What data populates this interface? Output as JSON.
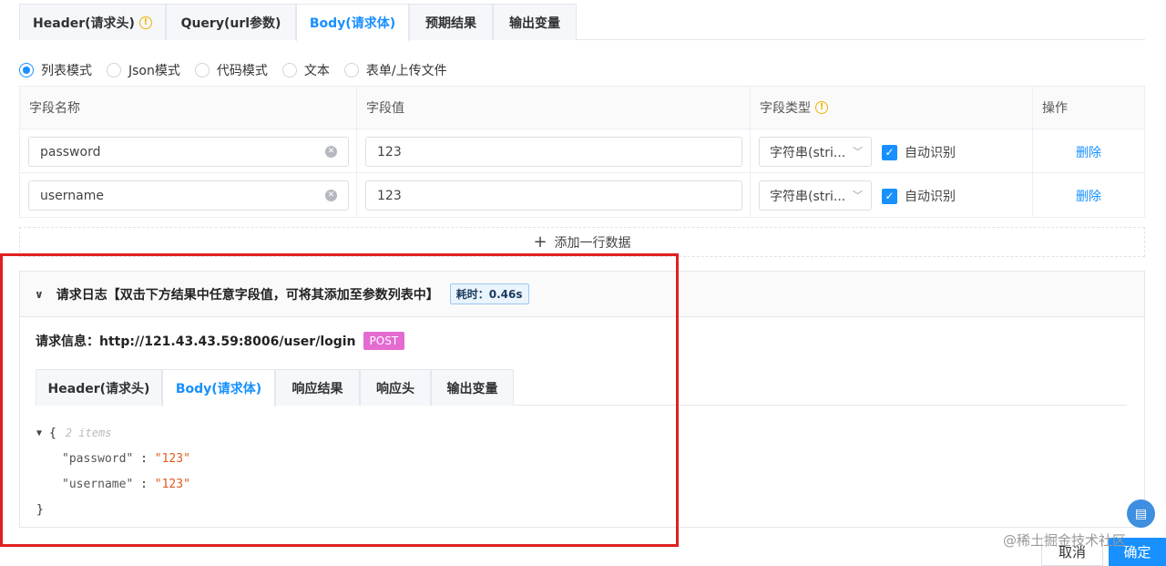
{
  "top_tabs": [
    {
      "label": "Header(请求头)"
    },
    {
      "label": "Query(url参数)"
    },
    {
      "label": "Body(请求体)"
    },
    {
      "label": "预期结果"
    },
    {
      "label": "输出变量"
    }
  ],
  "body_modes": [
    {
      "label": "列表模式"
    },
    {
      "label": "Json模式"
    },
    {
      "label": "代码模式"
    },
    {
      "label": "文本"
    },
    {
      "label": "表单/上传文件"
    }
  ],
  "table": {
    "headers": {
      "name": "字段名称",
      "value": "字段值",
      "type": "字段类型",
      "action": "操作"
    },
    "rows": [
      {
        "name": "password",
        "value": "123",
        "type": "字符串(stri...",
        "auto": "自动识别",
        "delete": "删除"
      },
      {
        "name": "username",
        "value": "123",
        "type": "字符串(stri...",
        "auto": "自动识别",
        "delete": "删除"
      }
    ],
    "add_row": "添加一行数据"
  },
  "log": {
    "title": "请求日志【双击下方结果中任意字段值，可将其添加至参数列表中】",
    "time_badge": "耗时：0.46s",
    "request_info": "请求信息：http://121.43.43.59:8006/user/login",
    "method": "POST",
    "tabs": [
      {
        "label": "Header(请求头)"
      },
      {
        "label": "Body(请求体)"
      },
      {
        "label": "响应结果"
      },
      {
        "label": "响应头"
      },
      {
        "label": "输出变量"
      }
    ],
    "json": {
      "open": "{",
      "items_note": "2 items",
      "entries": [
        {
          "key": "\"password\"",
          "sep": " : ",
          "value": "\"123\""
        },
        {
          "key": "\"username\"",
          "sep": " : ",
          "value": "\"123\""
        }
      ],
      "close": "}"
    }
  },
  "footer": {
    "watermark": "@稀土掘金技术社区",
    "cancel": "取消",
    "ok": "确定"
  },
  "colors": {
    "accent": "#1890ff",
    "highlight": "#e02020",
    "post_tag": "#e46bd2"
  }
}
